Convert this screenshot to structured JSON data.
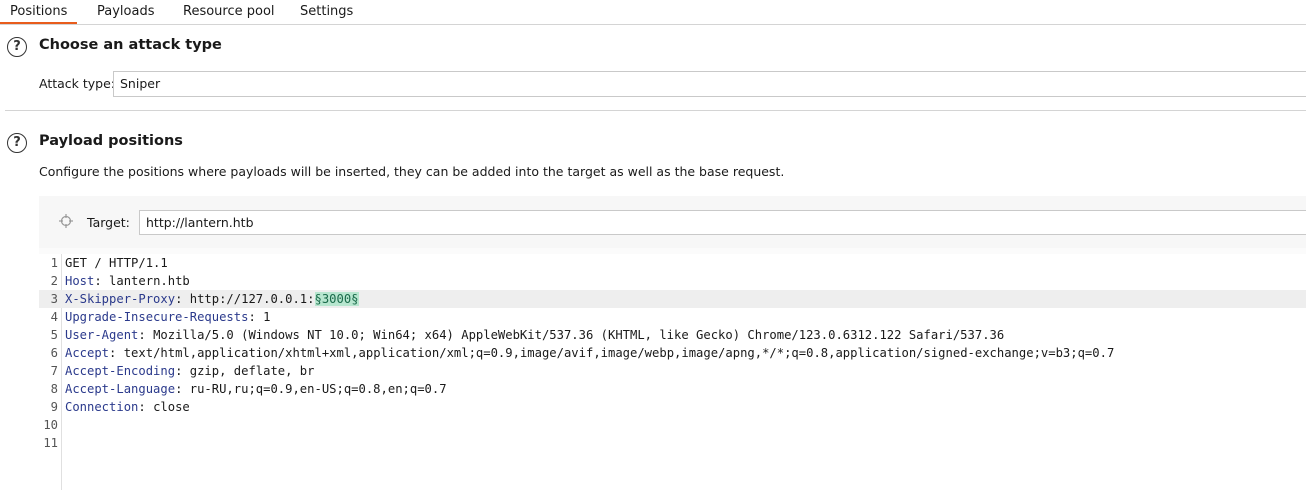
{
  "tabs": [
    {
      "label": "Positions",
      "active": true
    },
    {
      "label": "Payloads",
      "active": false
    },
    {
      "label": "Resource pool",
      "active": false
    },
    {
      "label": "Settings",
      "active": false
    }
  ],
  "attack_section": {
    "help_glyph": "?",
    "title": "Choose an attack type",
    "attack_type_label": "Attack type:",
    "attack_type_value": "Sniper"
  },
  "positions_section": {
    "help_glyph": "?",
    "title": "Payload positions",
    "description": "Configure the positions where payloads will be inserted, they can be added into the target as well as the base request.",
    "target_label": "Target:",
    "target_value": "http://lantern.htb",
    "target_icon": "crosshair-icon"
  },
  "request": {
    "lines": [
      {
        "n": "1",
        "name": "",
        "sep": "",
        "value": "GET / HTTP/1.1",
        "marker": ""
      },
      {
        "n": "2",
        "name": "Host",
        "sep": ": ",
        "value": "lantern.htb",
        "marker": ""
      },
      {
        "n": "3",
        "name": "X-Skipper-Proxy",
        "sep": ": ",
        "value": "http://127.0.0.1:",
        "marker": "§3000§"
      },
      {
        "n": "4",
        "name": "Upgrade-Insecure-Requests",
        "sep": ": ",
        "value": "1",
        "marker": ""
      },
      {
        "n": "5",
        "name": "User-Agent",
        "sep": ": ",
        "value": "Mozilla/5.0 (Windows NT 10.0; Win64; x64) AppleWebKit/537.36 (KHTML, like Gecko) Chrome/123.0.6312.122 Safari/537.36",
        "marker": ""
      },
      {
        "n": "6",
        "name": "Accept",
        "sep": ": ",
        "value": "text/html,application/xhtml+xml,application/xml;q=0.9,image/avif,image/webp,image/apng,*/*;q=0.8,application/signed-exchange;v=b3;q=0.7",
        "marker": ""
      },
      {
        "n": "7",
        "name": "Accept-Encoding",
        "sep": ": ",
        "value": "gzip, deflate, br",
        "marker": ""
      },
      {
        "n": "8",
        "name": "Accept-Language",
        "sep": ": ",
        "value": "ru-RU,ru;q=0.9,en-US;q=0.8,en;q=0.7",
        "marker": ""
      },
      {
        "n": "9",
        "name": "Connection",
        "sep": ": ",
        "value": "close",
        "marker": ""
      },
      {
        "n": "10",
        "name": "",
        "sep": "",
        "value": "",
        "marker": ""
      },
      {
        "n": "11",
        "name": "",
        "sep": "",
        "value": "",
        "marker": ""
      }
    ]
  },
  "colors": {
    "active_tab_underline": "#e85c1c",
    "header_name": "#2b3a8c",
    "payload_marker_bg": "#b7e6cf"
  }
}
